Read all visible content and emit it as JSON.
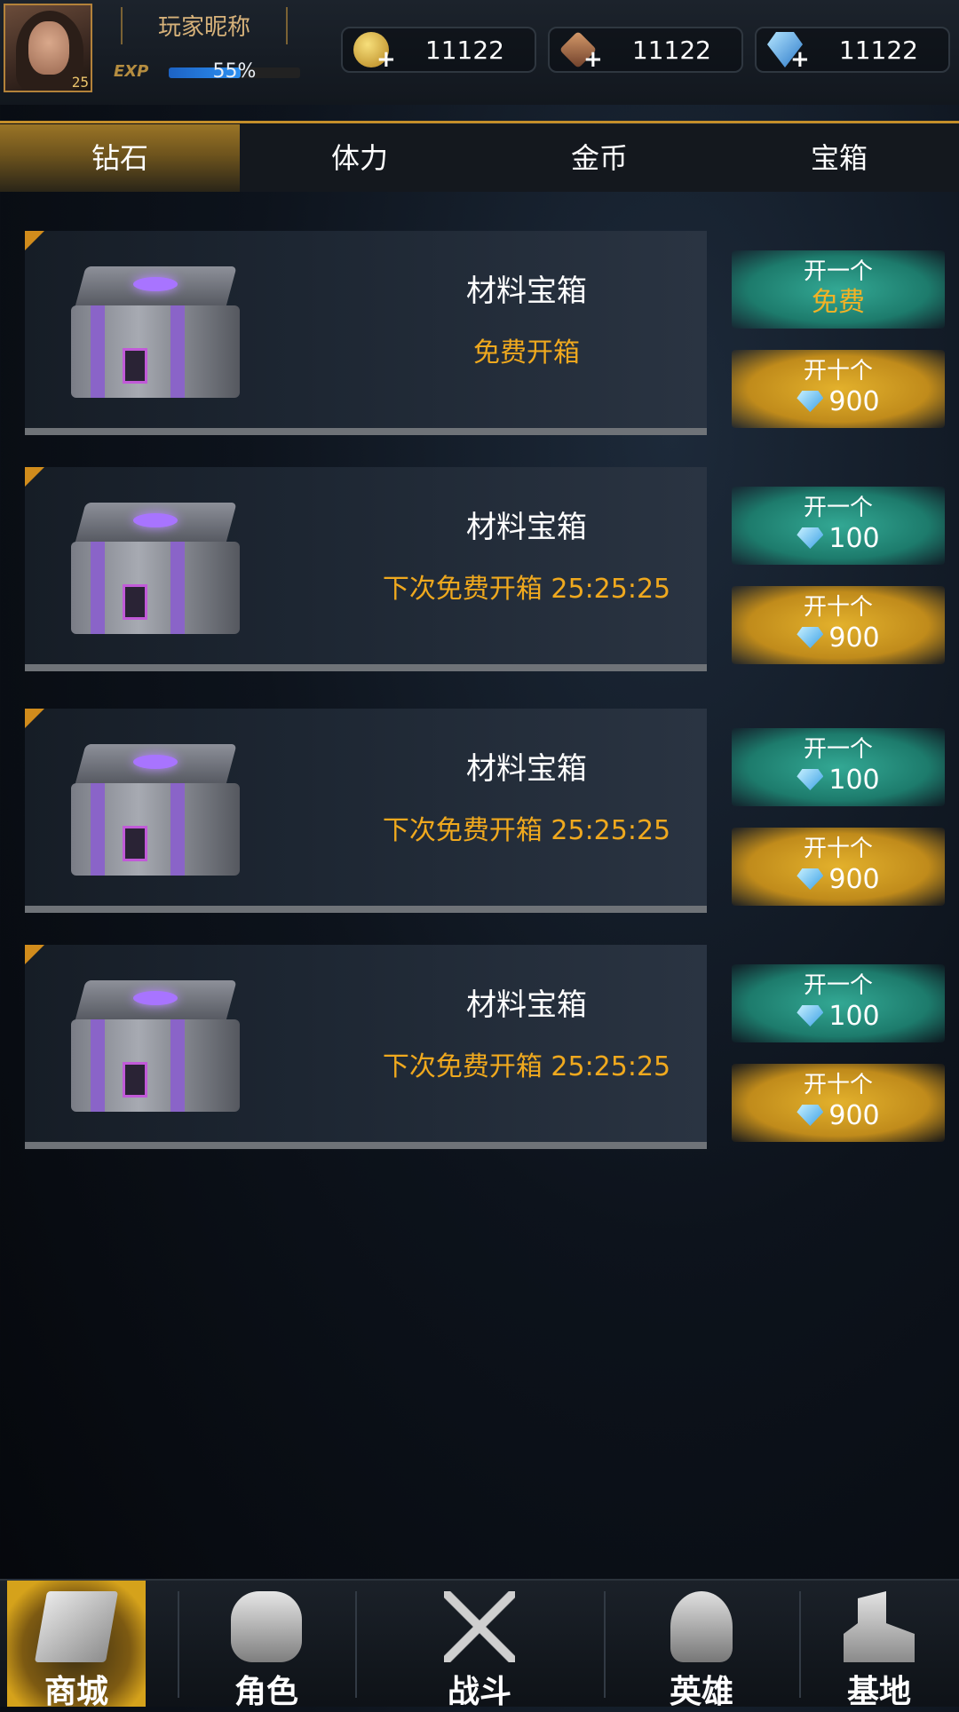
{
  "header": {
    "nickname": "玩家昵称",
    "level": "25",
    "exp_label": "EXP",
    "exp_text": "55%",
    "exp_fraction": 0.55,
    "resources": [
      {
        "icon": "coin-icon",
        "value": "11122"
      },
      {
        "icon": "ticket-icon",
        "value": "11122"
      },
      {
        "icon": "gem-icon",
        "value": "11122"
      }
    ]
  },
  "tabs": [
    {
      "label": "钻石"
    },
    {
      "label": "体力"
    },
    {
      "label": "金币"
    },
    {
      "label": "宝箱"
    }
  ],
  "chests": [
    {
      "title": "材料宝箱",
      "subtitle": "免费开箱",
      "open_one_label": "开一个",
      "open_one_price": "免费",
      "open_ten_label": "开十个",
      "open_ten_price": "900"
    },
    {
      "title": "材料宝箱",
      "subtitle": "下次免费开箱 25:25:25",
      "open_one_label": "开一个",
      "open_one_price": "100",
      "open_ten_label": "开十个",
      "open_ten_price": "900"
    },
    {
      "title": "材料宝箱",
      "subtitle": "下次免费开箱 25:25:25",
      "open_one_label": "开一个",
      "open_one_price": "100",
      "open_ten_label": "开十个",
      "open_ten_price": "900"
    },
    {
      "title": "材料宝箱",
      "subtitle": "下次免费开箱 25:25:25",
      "open_one_label": "开一个",
      "open_one_price": "100",
      "open_ten_label": "开十个",
      "open_ten_price": "900"
    }
  ],
  "nav": [
    {
      "label": "商城",
      "icon": "shop-icon"
    },
    {
      "label": "角色",
      "icon": "role-icon"
    },
    {
      "label": "战斗",
      "icon": "battle-icon"
    },
    {
      "label": "英雄",
      "icon": "hero-icon"
    },
    {
      "label": "基地",
      "icon": "base-icon"
    }
  ],
  "colors": {
    "accent_gold": "#c48e2a",
    "timer_orange": "#f0a91e",
    "button_teal": "#1d7b6c",
    "button_gold": "#c08b1b",
    "exp_blue": "#2c8ff0"
  }
}
